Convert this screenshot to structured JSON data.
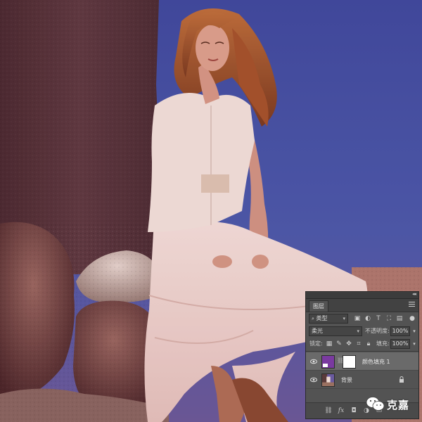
{
  "colors": {
    "sky": "#4a58a8",
    "fill_swatch": "#7a3aa0",
    "panel_bg": "#535353"
  },
  "layers_panel": {
    "tab_label": "图层",
    "filter_kind": "类型",
    "blend_mode": "柔光",
    "opacity_label": "不透明度:",
    "opacity_value": "100%",
    "lock_label": "锁定:",
    "fill_label": "填充:",
    "fill_value": "100%",
    "layers": [
      {
        "name": "颜色填充 1",
        "selected": true,
        "visible": true
      },
      {
        "name": "背景",
        "selected": false,
        "visible": true,
        "locked": true
      }
    ],
    "bottom_icons": [
      "link-icon",
      "fx-icon",
      "mask-icon",
      "adjustment-icon",
      "group-icon",
      "new-layer-icon",
      "trash-icon"
    ]
  },
  "watermark": {
    "text": "克嘉",
    "icon": "wechat-icon"
  }
}
